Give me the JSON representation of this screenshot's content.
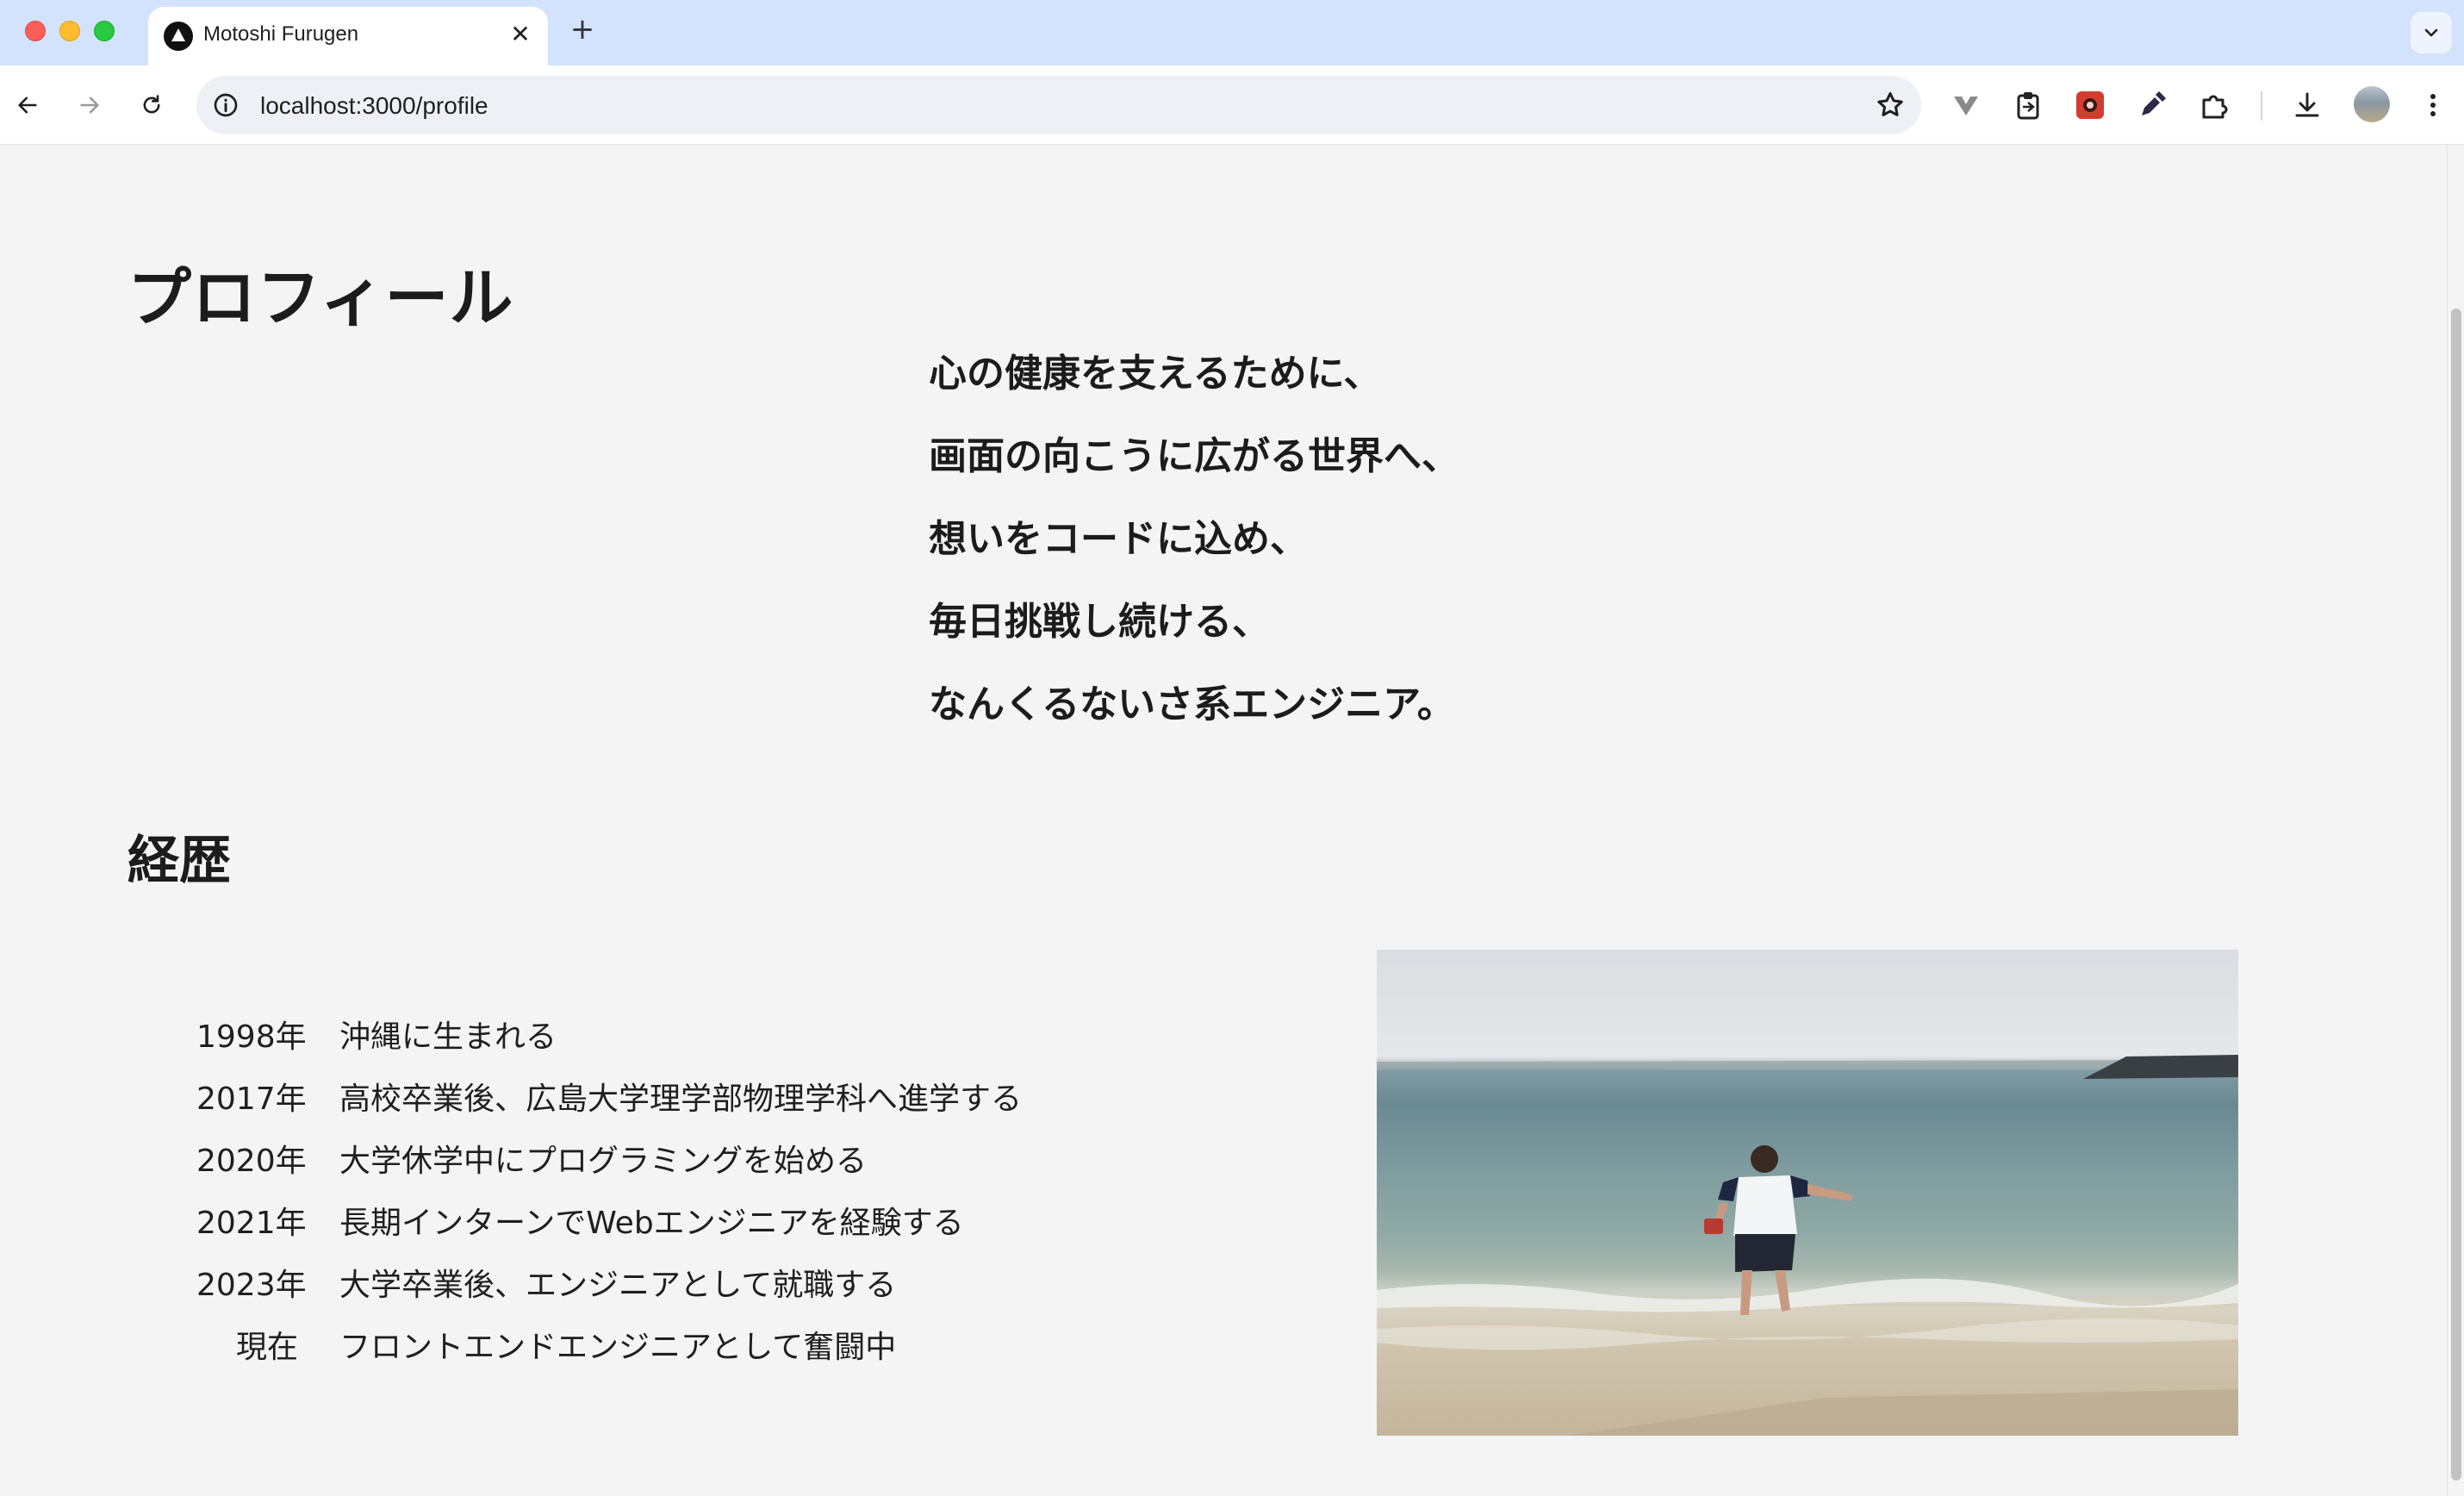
{
  "browser": {
    "tab_title": "Motoshi Furugen",
    "url": "localhost:3000/profile"
  },
  "page": {
    "heading": "プロフィール",
    "poem": [
      "心の健康を支えるために、",
      "画面の向こうに広がる世界へ、",
      "想いをコードに込め、",
      "毎日挑戦し続ける、",
      "なんくるないさ系エンジニア。"
    ],
    "history_heading": "経歴",
    "history": [
      {
        "year": "1998年",
        "text": "沖縄に生まれる"
      },
      {
        "year": "2017年",
        "text": "高校卒業後、広島大学理学部物理学科へ進学する"
      },
      {
        "year": "2020年",
        "text": "大学休学中にプログラミングを始める"
      },
      {
        "year": "2021年",
        "text": "長期インターンでWebエンジニアを経験する"
      },
      {
        "year": "2023年",
        "text": "大学卒業後、エンジニアとして就職する"
      },
      {
        "year": "現在",
        "text": "フロントエンドエンジニアとして奮闘中"
      }
    ]
  }
}
